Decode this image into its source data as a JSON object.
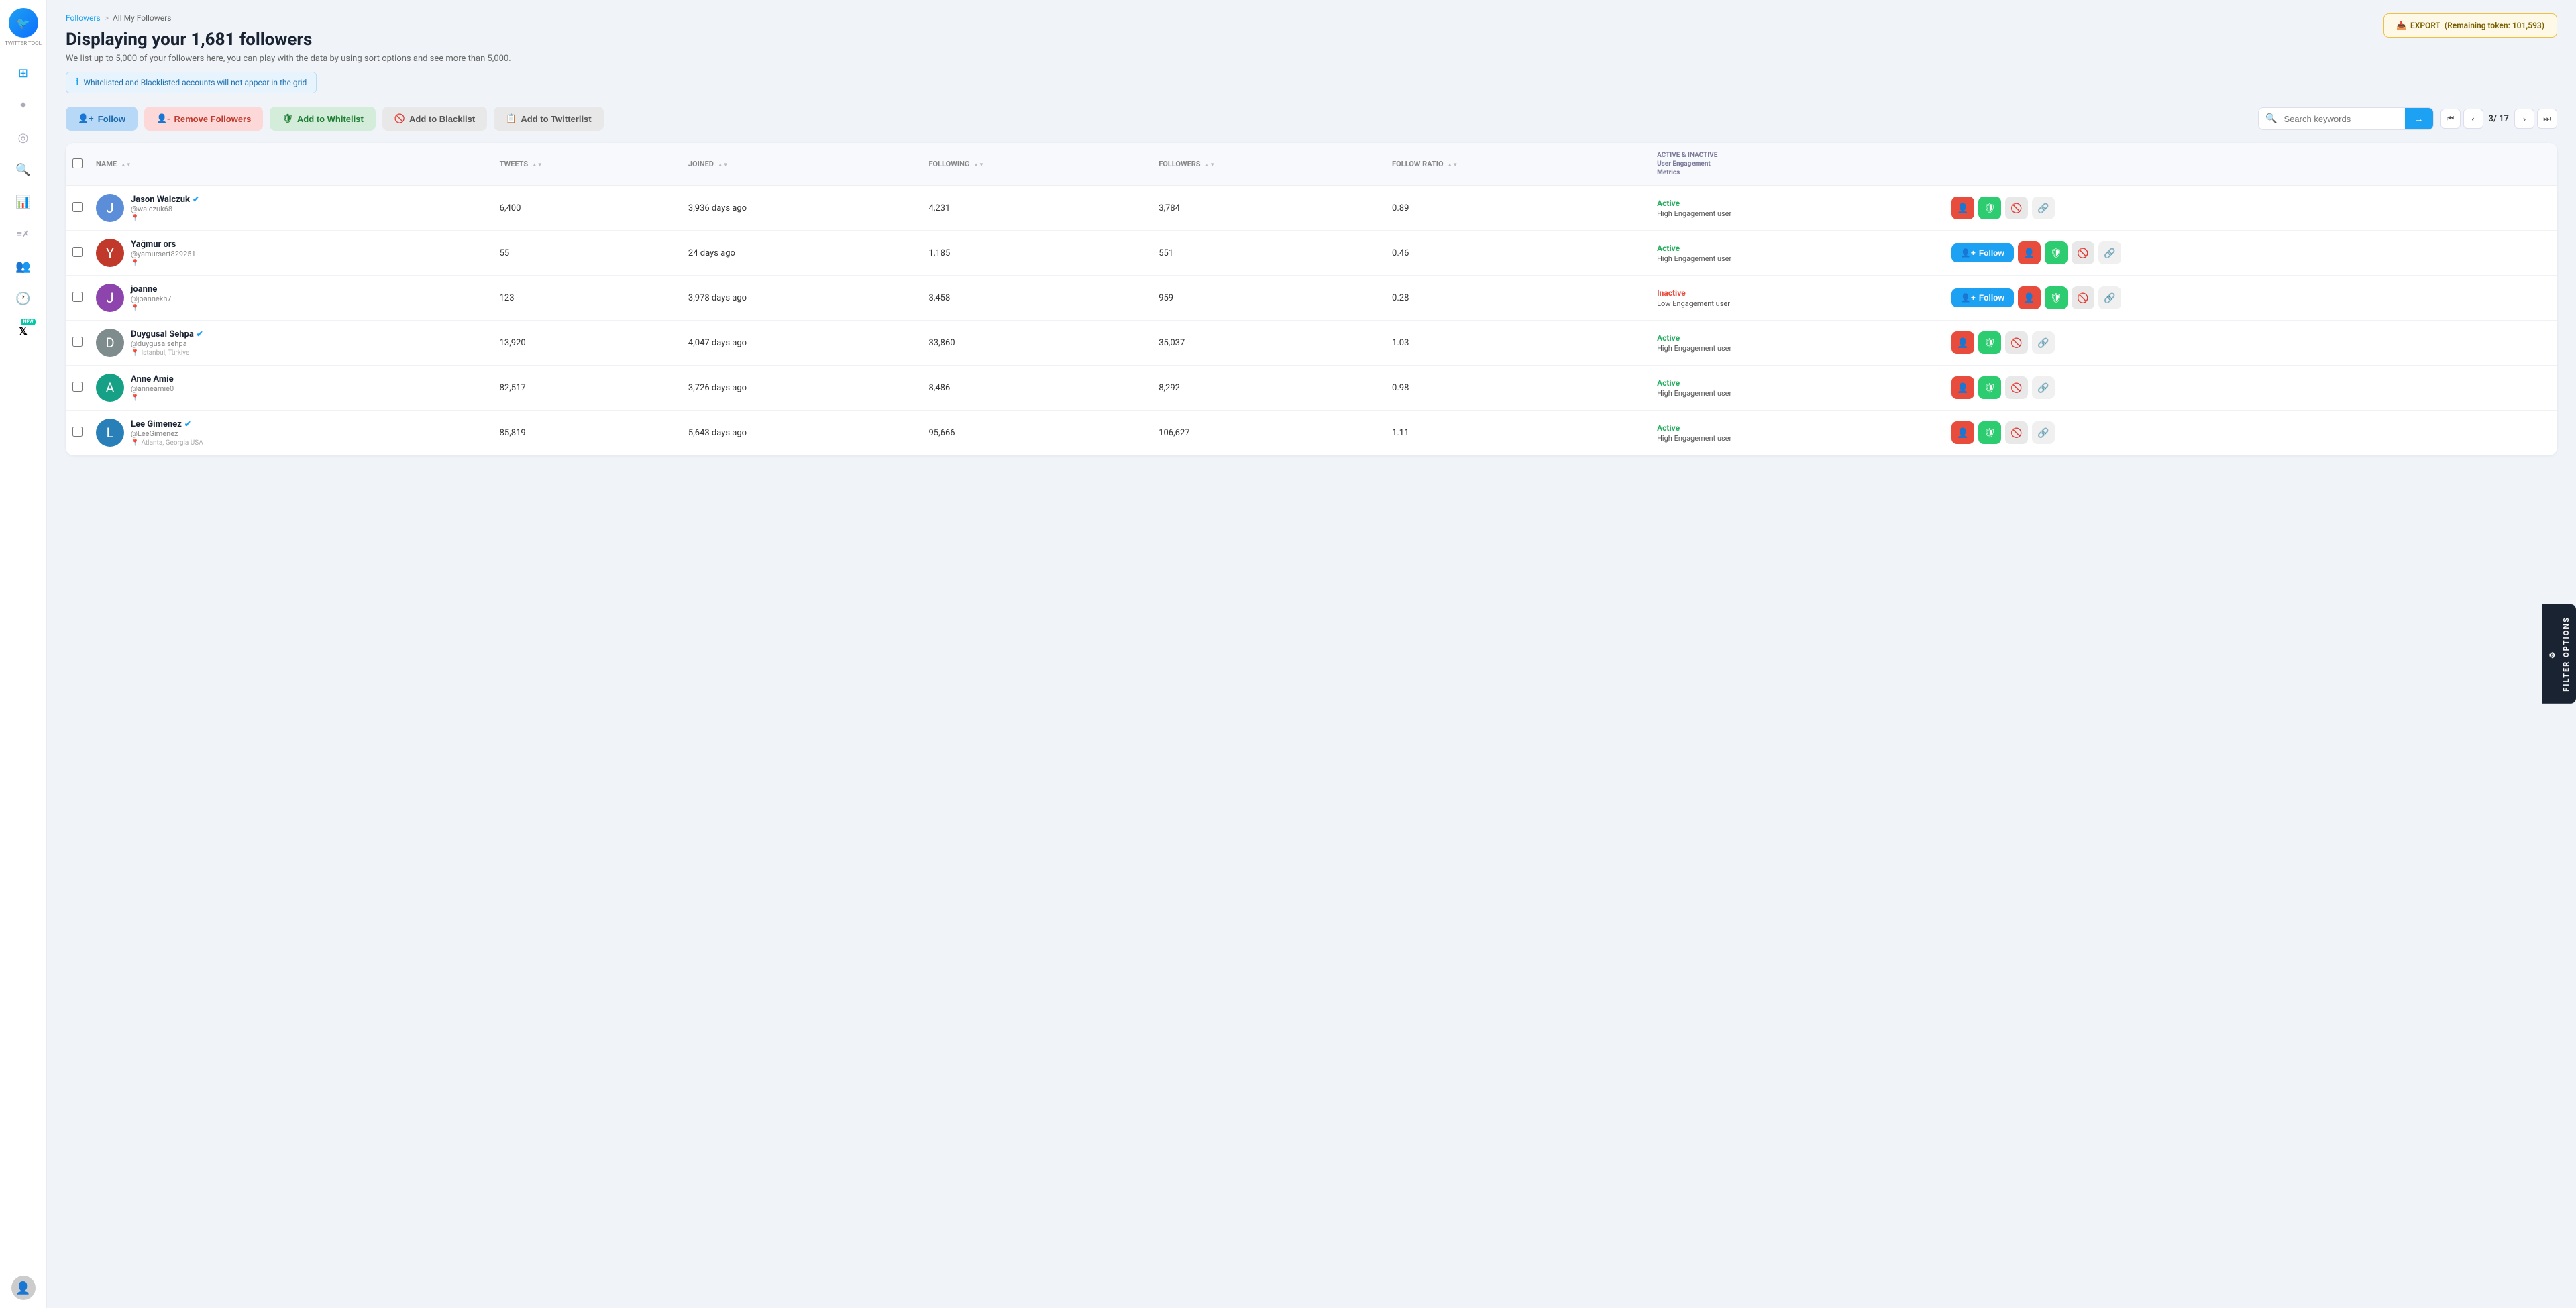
{
  "sidebar": {
    "logo_text": "TWITTER TOOL",
    "icons": [
      {
        "name": "grid-icon",
        "symbol": "⊞",
        "active": false
      },
      {
        "name": "network-icon",
        "symbol": "✦",
        "active": false
      },
      {
        "name": "target-icon",
        "symbol": "◎",
        "active": false
      },
      {
        "name": "search-icon",
        "symbol": "🔍",
        "active": false
      },
      {
        "name": "chart-icon",
        "symbol": "📊",
        "active": false
      },
      {
        "name": "list-x-icon",
        "symbol": "≡✗",
        "active": false
      },
      {
        "name": "people-icon",
        "symbol": "👥",
        "active": false
      },
      {
        "name": "clock-icon",
        "symbol": "🕐",
        "active": false
      },
      {
        "name": "x-icon",
        "symbol": "𝕏",
        "active": false,
        "badge": "NEW"
      }
    ]
  },
  "export_btn": {
    "label": "EXPORT",
    "token_info": "Remaining token: 101,593"
  },
  "breadcrumb": {
    "items": [
      "Followers",
      "All My Followers"
    ],
    "separator": ">"
  },
  "page": {
    "title": "Displaying your 1,681 followers",
    "subtitle": "We list up to 5,000 of your followers here, you can play with the data by using sort options and see more than 5,000.",
    "info_banner": "Whitelisted and Blacklisted accounts will not appear in the grid"
  },
  "action_bar": {
    "follow_label": "Follow",
    "remove_label": "Remove Followers",
    "whitelist_label": "Add to Whitelist",
    "blacklist_label": "Add to Blacklist",
    "twitterlist_label": "Add to Twitterlist",
    "search_placeholder": "Search keywords"
  },
  "pagination": {
    "current_page": "3",
    "total_pages": "17",
    "display": "3/ 17"
  },
  "table": {
    "columns": [
      "NAME",
      "TWEETS",
      "JOINED",
      "FOLLOWING",
      "FOLLOWERS",
      "FOLLOW RATIO",
      "ACTIVE & INACTIVE\nUser Engagement\nMetrics"
    ],
    "rows": [
      {
        "id": 1,
        "name": "Jason Walczuk",
        "handle": "@walczuk68",
        "verified": true,
        "location": "",
        "avatar_color": "#5b8dd9",
        "avatar_letter": "J",
        "tweets": "6,400",
        "joined": "3,936 days ago",
        "following": "4,231",
        "followers": "3,784",
        "follow_ratio": "0.89",
        "status": "Active",
        "engagement": "High Engagement user",
        "is_following": false
      },
      {
        "id": 2,
        "name": "Yağmur ors",
        "handle": "@yamursert829251",
        "verified": false,
        "location": "",
        "avatar_color": "#c0392b",
        "avatar_letter": "Y",
        "tweets": "55",
        "joined": "24 days ago",
        "following": "1,185",
        "followers": "551",
        "follow_ratio": "0.46",
        "status": "Active",
        "engagement": "High Engagement user",
        "is_following": true
      },
      {
        "id": 3,
        "name": "joanne",
        "handle": "@joannekh7",
        "verified": false,
        "location": "",
        "avatar_color": "#8e44ad",
        "avatar_letter": "J",
        "tweets": "123",
        "joined": "3,978 days ago",
        "following": "3,458",
        "followers": "959",
        "follow_ratio": "0.28",
        "status": "Inactive",
        "engagement": "Low Engagement user",
        "is_following": true
      },
      {
        "id": 4,
        "name": "Duygusal Sehpa",
        "handle": "@duygusalsehpa",
        "verified": true,
        "location": "Istanbul, Türkiye",
        "avatar_color": "#7f8c8d",
        "avatar_letter": "D",
        "tweets": "13,920",
        "joined": "4,047 days ago",
        "following": "33,860",
        "followers": "35,037",
        "follow_ratio": "1.03",
        "status": "Active",
        "engagement": "High Engagement user",
        "is_following": false
      },
      {
        "id": 5,
        "name": "Anne Amie",
        "handle": "@anneamie0",
        "verified": false,
        "location": "",
        "avatar_color": "#16a085",
        "avatar_letter": "A",
        "tweets": "82,517",
        "joined": "3,726 days ago",
        "following": "8,486",
        "followers": "8,292",
        "follow_ratio": "0.98",
        "status": "Active",
        "engagement": "High Engagement user",
        "is_following": false
      },
      {
        "id": 6,
        "name": "Lee Gimenez",
        "handle": "@LeeGimenez",
        "verified": true,
        "location": "Atlanta, Georgia USA",
        "avatar_color": "#2980b9",
        "avatar_letter": "L",
        "tweets": "85,819",
        "joined": "5,643 days ago",
        "following": "95,666",
        "followers": "106,627",
        "follow_ratio": "1.11",
        "status": "Active",
        "engagement": "High Engagement user",
        "is_following": false
      }
    ]
  },
  "filter_tab_label": "FILTER OPTIONS"
}
